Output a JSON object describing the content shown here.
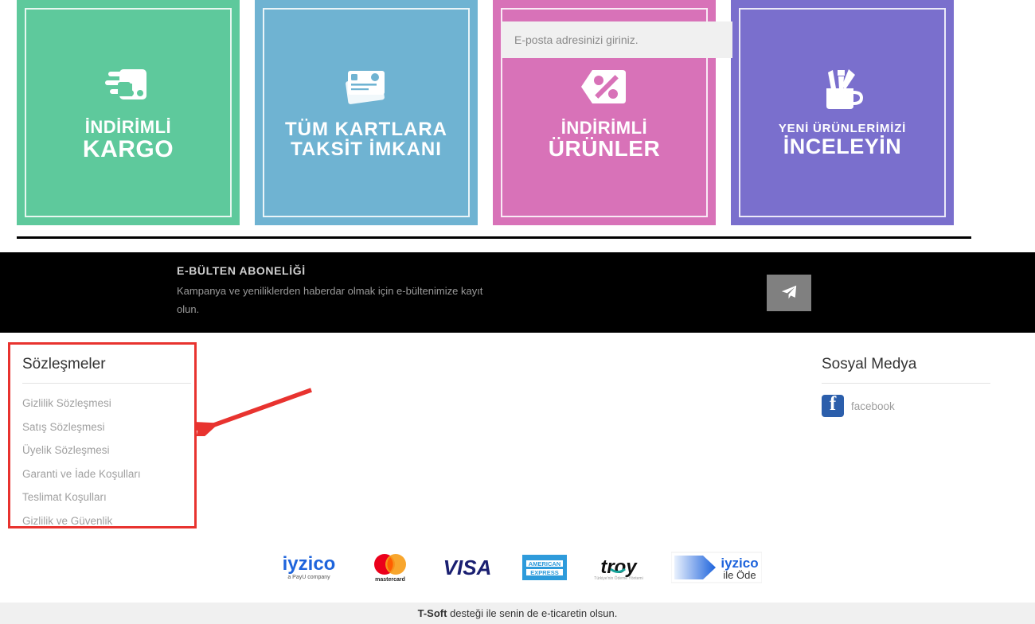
{
  "banners": [
    {
      "icon": "cargo-truck-icon",
      "line1": "İNDİRİMLİ",
      "line2": "KARGO",
      "color": "#5ec99c"
    },
    {
      "icon": "credit-cards-icon",
      "line1": "TÜM KARTLARA",
      "line2": "TAKSİT İMKANI",
      "color": "#6fb3d2"
    },
    {
      "icon": "discount-percent-tag-icon",
      "line1": "İNDİRİMLİ",
      "line2": "ÜRÜNLER",
      "color": "#d872b8"
    },
    {
      "icon": "brush-cup-icon",
      "line1": "YENİ ÜRÜNLERİMİZİ",
      "line2": "İNCELEYİN",
      "color": "#7a6fcd"
    }
  ],
  "newsletter": {
    "title": "E-BÜLTEN ABONELİĞİ",
    "description": "Kampanya ve yeniliklerden haberdar olmak için e-bültenimize kayıt olun.",
    "input_placeholder": "E-posta adresinizi giriniz.",
    "input_value": "",
    "send_icon": "paper-plane-icon",
    "background_color": "#000000",
    "button_color": "#808080"
  },
  "footer": {
    "agreements": {
      "heading": "Sözleşmeler",
      "links": [
        "Gizlilik Sözleşmesi",
        "Satış Sözleşmesi",
        "Üyelik Sözleşmesi",
        "Garanti ve İade Koşulları",
        "Teslimat Koşulları",
        "Gizlilik ve Güvenlik"
      ]
    },
    "social": {
      "heading": "Sosyal Medya",
      "items": [
        {
          "icon": "facebook-icon",
          "label": "facebook",
          "color": "#2b5eab"
        }
      ]
    },
    "payment_logos": [
      "iyzico",
      "mastercard",
      "VISA",
      "AMERICAN EXPRESS",
      "troy",
      "iyzico ile Öde"
    ],
    "payment_sub": {
      "iyzico": "a PayU company",
      "mastercard": "mastercard",
      "iyzico_ile_ode": "ile Öde"
    },
    "bottom_bar": {
      "brand": "T-Soft",
      "text": " desteği ile senin de e-ticaretin olsun."
    }
  },
  "annotation": {
    "type": "arrow",
    "color": "#e8332f",
    "target": "agreements-footer-column"
  }
}
